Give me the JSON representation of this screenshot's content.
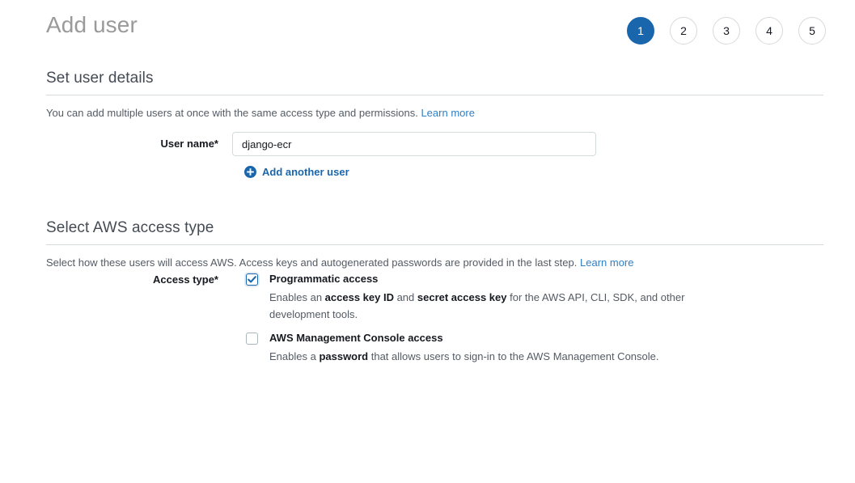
{
  "header": {
    "title": "Add user",
    "steps": [
      {
        "label": "1",
        "active": true
      },
      {
        "label": "2",
        "active": false
      },
      {
        "label": "3",
        "active": false
      },
      {
        "label": "4",
        "active": false
      },
      {
        "label": "5",
        "active": false
      }
    ]
  },
  "user_details": {
    "section_title": "Set user details",
    "description": "You can add multiple users at once with the same access type and permissions.",
    "learn_more": "Learn more",
    "user_name_label": "User name*",
    "user_name_value": "django-ecr",
    "user_name_placeholder": "",
    "add_another_label": "Add another user"
  },
  "access_type": {
    "section_title": "Select AWS access type",
    "description": "Select how these users will access AWS. Access keys and autogenerated passwords are provided in the last step.",
    "learn_more": "Learn more",
    "field_label": "Access type*",
    "options": [
      {
        "title": "Programmatic access",
        "checked": true,
        "desc_1": "Enables an ",
        "desc_bold_1": "access key ID",
        "desc_2": " and ",
        "desc_bold_2": "secret access key",
        "desc_3": " for the AWS API, CLI, SDK, and other development tools."
      },
      {
        "title": "AWS Management Console access",
        "checked": false,
        "desc_1": "Enables a ",
        "desc_bold_1": "password",
        "desc_2": " that allows users to sign-in to the AWS Management Console.",
        "desc_bold_2": "",
        "desc_3": ""
      }
    ]
  },
  "colors": {
    "accent_blue": "#1a66ad",
    "link_blue": "#2e7fc4",
    "title_gray": "#9a9a9a",
    "body_gray": "#545b64",
    "border_gray": "#d5dbdb"
  }
}
